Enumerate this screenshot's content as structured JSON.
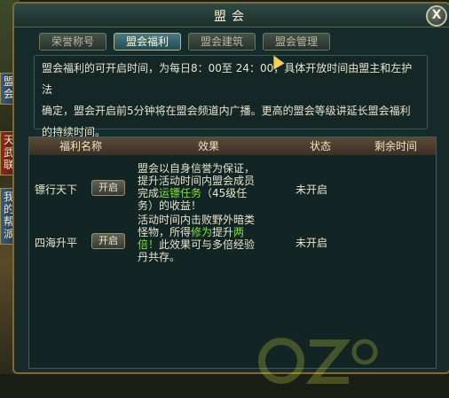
{
  "window": {
    "title": "盟会",
    "close_symbol": "X"
  },
  "side_tabs": [
    "盟会",
    "天武联",
    "我的帮派"
  ],
  "tabs": [
    {
      "label": "荣誉称号",
      "active": false
    },
    {
      "label": "盟会福利",
      "active": true
    },
    {
      "label": "盟会建筑",
      "active": false
    },
    {
      "label": "盟会管理",
      "active": false
    }
  ],
  "description": {
    "line1": "盟会福利的可开启时间，为每日8：00至 24：00，具体开放时间由盟主和左护法",
    "line2": "确定，盟会开启前5分钟将在盟会频道内广播。更高的盟会等级讲延长盟会福利",
    "line3": "的持续时间。"
  },
  "table": {
    "headers": [
      "福利名称",
      "效果",
      "状态",
      "剩余时间"
    ],
    "rows": [
      {
        "name": "镖行天下",
        "button": "开启",
        "effect_lines": [
          {
            "text": "盟会以自身信誉为保证，",
            "highlight": ""
          },
          {
            "text": "提升活动时间内盟会成员",
            "highlight": ""
          },
          {
            "text": "完成",
            "highlight": "运镖任务",
            "after": "（45级任"
          },
          {
            "text": "务）的收益！",
            "highlight": ""
          }
        ],
        "status": "未开启",
        "remaining": ""
      },
      {
        "name": "四海升平",
        "button": "开启",
        "effect_lines": [
          {
            "text": "活动时间内击败野外暗类",
            "highlight": ""
          },
          {
            "text": "怪物，所得",
            "highlight": "修为",
            "after": "提升",
            "highlight2": "两"
          },
          {
            "text": "",
            "highlight": "倍！",
            "after": "此效果可与多倍经验"
          },
          {
            "text": "丹共存。",
            "highlight": ""
          }
        ],
        "status": "未开启",
        "remaining": ""
      }
    ]
  },
  "colors": {
    "highlight": "#7ee33a",
    "accent": "#4a7a86"
  }
}
